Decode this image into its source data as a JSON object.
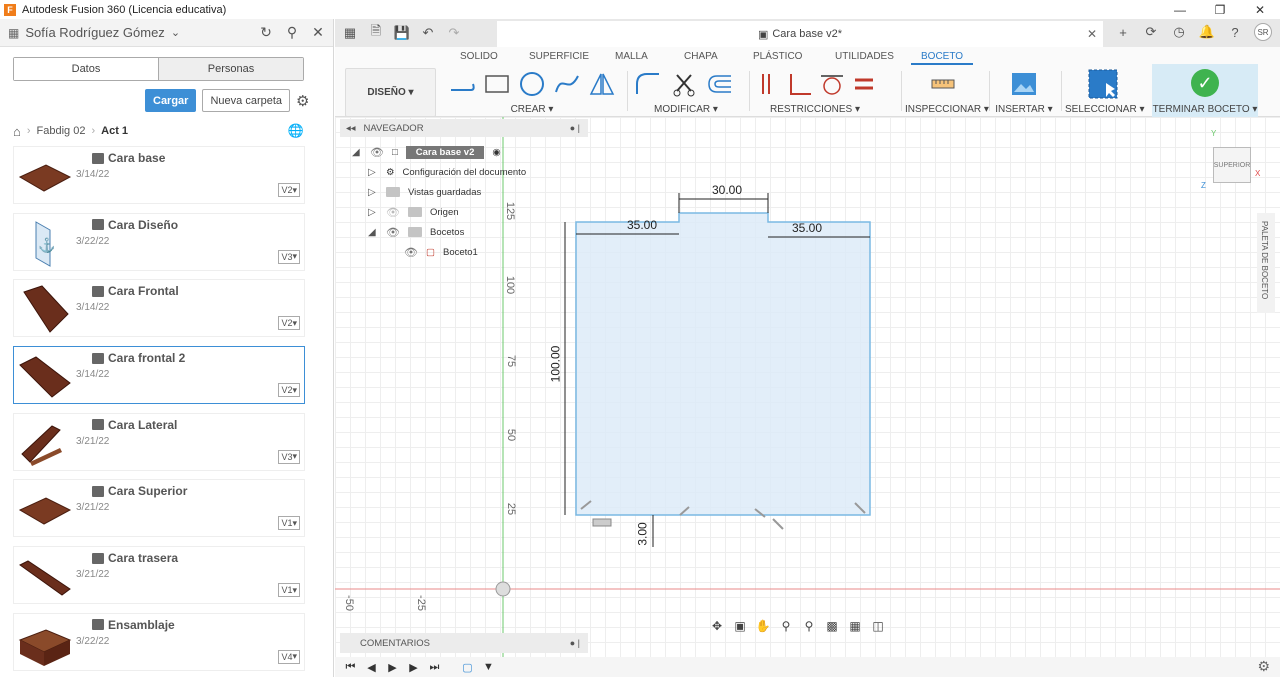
{
  "window": {
    "app_title": "Autodesk Fusion 360 (Licencia educativa)",
    "logo_letter": "F"
  },
  "data_panel": {
    "user_name": "Sofía Rodríguez Gómez",
    "tabs": [
      "Datos",
      "Personas"
    ],
    "upload_label": "Cargar",
    "new_folder_label": "Nueva carpeta",
    "breadcrumb": [
      "Fabdig 02",
      "Act 1"
    ],
    "files": [
      {
        "name": "Cara base",
        "date": "3/14/22",
        "version": "V2"
      },
      {
        "name": "Cara Diseño",
        "date": "3/22/22",
        "version": "V3"
      },
      {
        "name": "Cara Frontal",
        "date": "3/14/22",
        "version": "V2"
      },
      {
        "name": "Cara frontal 2",
        "date": "3/14/22",
        "version": "V2"
      },
      {
        "name": "Cara Lateral",
        "date": "3/21/22",
        "version": "V3"
      },
      {
        "name": "Cara Superior",
        "date": "3/21/22",
        "version": "V1"
      },
      {
        "name": "Cara trasera",
        "date": "3/21/22",
        "version": "V1"
      },
      {
        "name": "Ensamblaje",
        "date": "3/22/22",
        "version": "V4"
      }
    ]
  },
  "document_tab": {
    "title": "Cara base v2*",
    "user_initials": "SR"
  },
  "ribbon": {
    "tabs": [
      "SOLIDO",
      "SUPERFICIE",
      "MALLA",
      "CHAPA",
      "PLÁSTICO",
      "UTILIDADES",
      "BOCETO"
    ],
    "workspace": "DISEÑO",
    "groups": {
      "create": "CREAR",
      "modify": "MODIFICAR",
      "constraints": "RESTRICCIONES",
      "inspect": "INSPECCIONAR",
      "insert": "INSERTAR",
      "select": "SELECCIONAR",
      "finish": "TERMINAR BOCETO"
    }
  },
  "navigator": {
    "title": "NAVEGADOR",
    "root": "Cara base v2",
    "items": [
      "Configuración del documento",
      "Vistas guardadas",
      "Origen",
      "Bocetos",
      "Boceto1"
    ]
  },
  "comments_label": "COMENTARIOS",
  "palette_label": "PALETA DE BOCETO",
  "viewcube_label": "SUPERIOR",
  "axes": {
    "x": "X",
    "y": "Y",
    "z": "Z"
  },
  "sketch": {
    "dimensions": {
      "top_notch": "30.00",
      "top_left": "35.00",
      "top_right": "35.00",
      "height": "100.00",
      "notch_depth": "3.00"
    },
    "ruler_vertical": [
      "125",
      "100",
      "75",
      "50",
      "25"
    ],
    "ruler_horizontal": [
      "-50",
      "-25"
    ]
  }
}
